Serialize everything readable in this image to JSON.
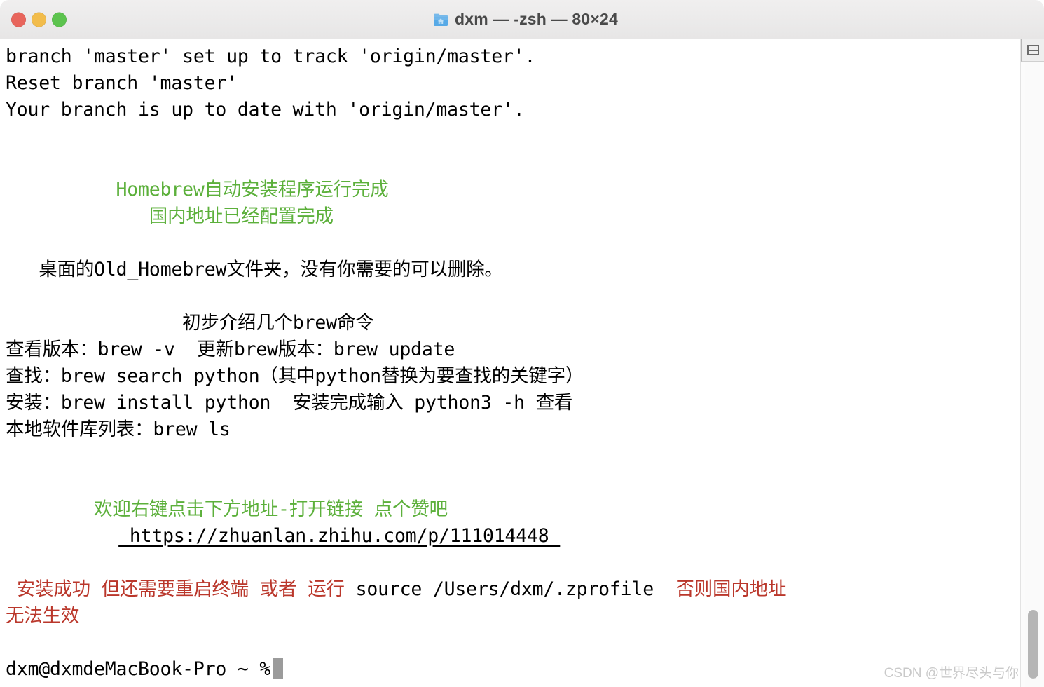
{
  "window": {
    "title": "dxm — -zsh — 80×24",
    "icon": "home-folder-icon",
    "traffic_lights": {
      "close": "#e8655c",
      "minimize": "#f2bc4b",
      "zoom": "#5cc34e"
    }
  },
  "colors": {
    "green": "#5cb03b",
    "red": "#ba372b",
    "black": "#000000",
    "cursor": "#9b9b9b",
    "watermark": "#c9c9c9"
  },
  "terminal": {
    "lines": {
      "l1": "branch 'master' set up to track 'origin/master'.",
      "l2": "Reset branch 'master'",
      "l3": "Your branch is up to date with 'origin/master'.",
      "l4": "",
      "l5": "",
      "l6_green": "          Homebrew自动安装程序运行完成",
      "l7_green": "             国内地址已经配置完成",
      "l8": "",
      "l9": "   桌面的Old_Homebrew文件夹，没有你需要的可以删除。",
      "l10": "",
      "l11": "                初步介绍几个brew命令",
      "l12": "查看版本：brew -v  更新brew版本：brew update",
      "l13": "查找：brew search python（其中python替换为要查找的关键字）",
      "l14": "安装：brew install python  安装完成输入 python3 -h 查看",
      "l15": "本地软件库列表：brew ls",
      "l16": "",
      "l17": "",
      "l18_green": "        欢迎右键点击下方地址-打开链接 点个赞吧",
      "l19_link": " https://zhuanlan.zhihu.com/p/111014448 ",
      "l20": "",
      "l21_red_a": " 安装成功 但还需要重启终端 或者 运行 ",
      "l21_black": "source /Users/dxm/.zprofile",
      "l21_red_b": "  否则国内地址",
      "l22_red": "无法生效",
      "l23": "",
      "prompt": "dxm@dxmdeMacBook-Pro ~ %"
    }
  },
  "watermark": {
    "text": "CSDN @世界尽头与你"
  }
}
